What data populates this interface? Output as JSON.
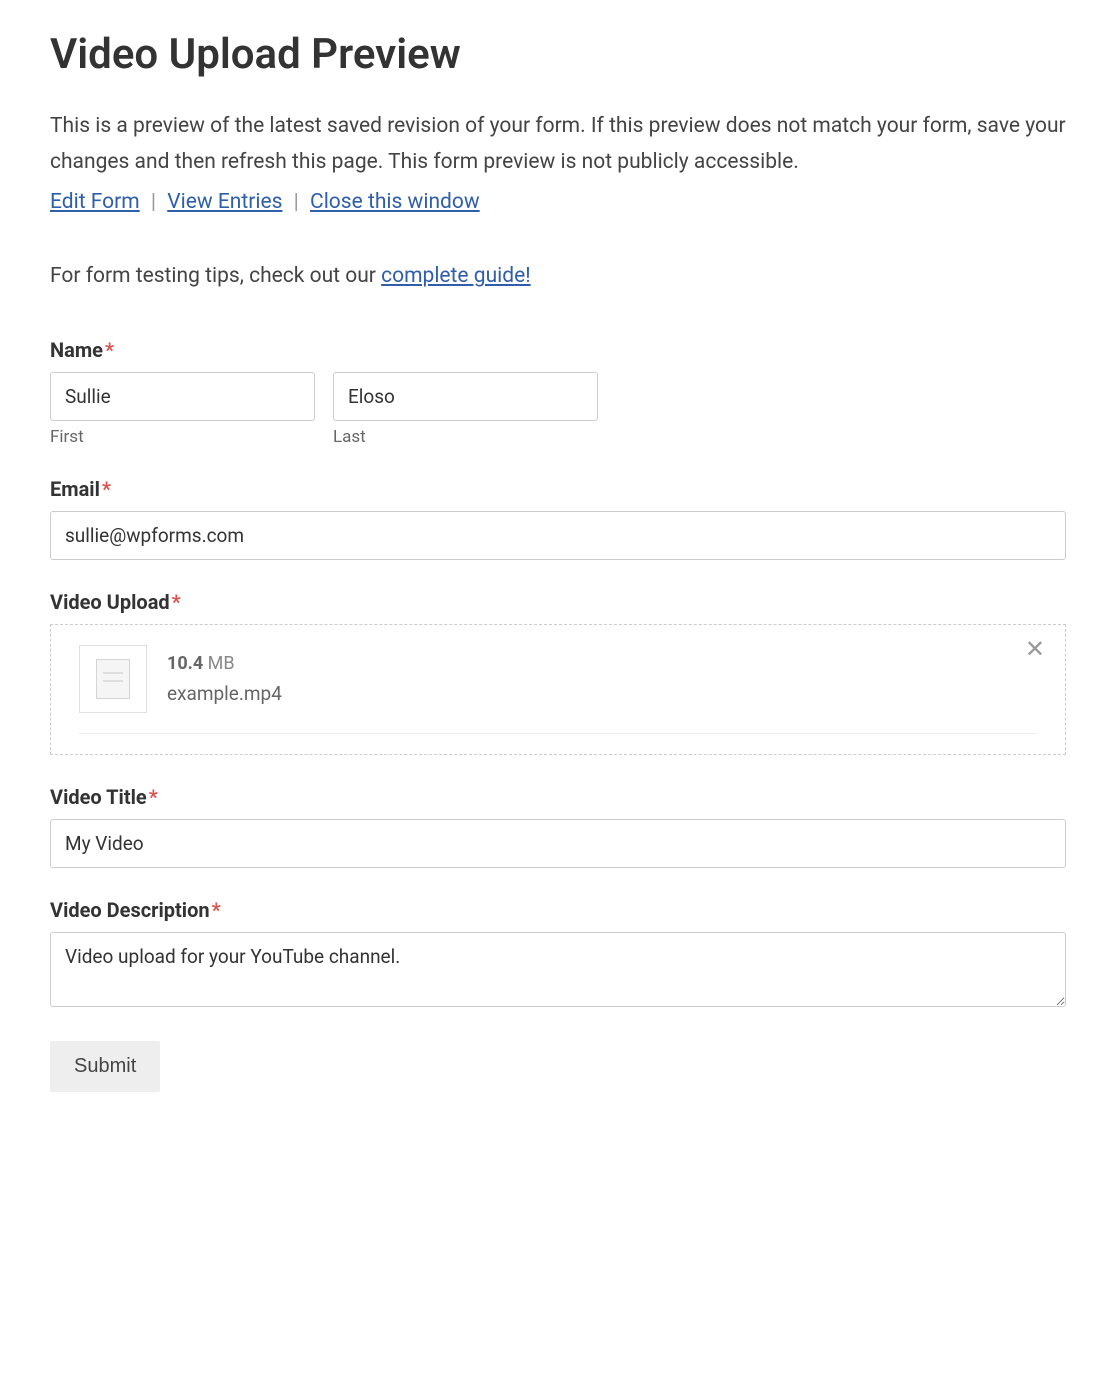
{
  "page_title": "Video Upload Preview",
  "intro": "This is a preview of the latest saved revision of your form. If this preview does not match your form, save your changes and then refresh this page. This form preview is not publicly accessible.",
  "links": {
    "edit": "Edit Form",
    "view": "View Entries",
    "close": "Close this window"
  },
  "tips_prefix": "For form testing tips, check out our ",
  "tips_link": "complete guide!",
  "fields": {
    "name": {
      "label": "Name",
      "first_value": "Sullie",
      "first_sublabel": "First",
      "last_value": "Eloso",
      "last_sublabel": "Last"
    },
    "email": {
      "label": "Email",
      "value": "sullie@wpforms.com"
    },
    "upload": {
      "label": "Video Upload",
      "file_size_num": "10.4",
      "file_size_unit": " MB",
      "file_name": "example.mp4"
    },
    "title": {
      "label": "Video Title",
      "value": "My Video"
    },
    "description": {
      "label": "Video Description",
      "value": "Video upload for your YouTube channel."
    }
  },
  "submit_label": "Submit"
}
